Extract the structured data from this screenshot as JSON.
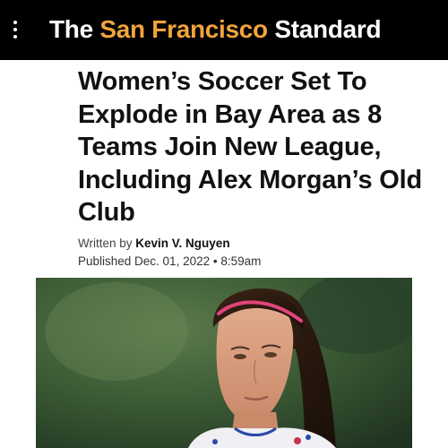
{
  "header": {
    "menu_icon": "vertical-dots-icon",
    "brand_prefix": "The ",
    "brand_accent": "San Francisco",
    "brand_suffix": " Standard",
    "colors": {
      "bar": "#000000",
      "brand_text": "#ffffff",
      "brand_accent": "#f2a33c"
    }
  },
  "article": {
    "headline": "Women’s Soccer Set To Explode in Bay Area as 8 Teams Join New League, Including Alex Morgan’s Old Club",
    "byline_prefix": "Written by ",
    "author": "Kevin V. Nguyen",
    "published": "Published Dec. 01, 2022 • 8:59am"
  }
}
